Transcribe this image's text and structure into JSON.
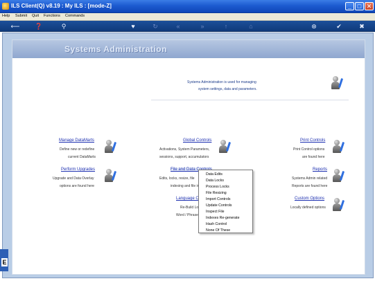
{
  "window": {
    "title": "ILS Client(Q) v8.19 : My ILS :          [mode-Z]",
    "min_glyph": "_",
    "max_glyph": "□",
    "close_glyph": "✕"
  },
  "menubar": {
    "items": [
      "Help",
      "Submit",
      "Quit",
      "Functions",
      "Commands"
    ]
  },
  "toolbar": {
    "icons": [
      "back-arrow-icon",
      "help-icon",
      "search-icon",
      "heart-icon",
      "refresh-icon",
      "rewind-icon",
      "fast-forward-icon",
      "up-icon",
      "lock-icon",
      "globe-icon",
      "check-icon",
      "close-icon"
    ]
  },
  "page": {
    "title": "Systems Administration",
    "intro_line1": "Systems Administration is used for managing",
    "intro_line2": "system settings, data and parameters."
  },
  "sections": {
    "manage_datamarts": {
      "title": "Manage DataMarts",
      "line1": "Define new or redefine",
      "line2": "current DataMarts"
    },
    "global_controls": {
      "title": "Global Controls",
      "line1": "Activations, System Parameters,",
      "line2": "sessions, support, accumulators"
    },
    "print_controls": {
      "title": "Print Controls",
      "line1": "Print Control options",
      "line2": "are found here"
    },
    "perform_upgrades": {
      "title": "Perform Upgrades",
      "line1": "Upgrade and Data Overlay",
      "line2": "options are found here"
    },
    "file_and_data_controls": {
      "title": "File and Data Controls",
      "line1": "Edits, locks, resize, file",
      "line2": "indexing and file in"
    },
    "reports": {
      "title": "Reports",
      "line1": "Systems Admin related",
      "line2": "Reports are found here"
    },
    "language_controls": {
      "title": "Language C",
      "line1": "Re-Build Lov",
      "line2": "Word / Phrase"
    },
    "custom_options": {
      "title": "Custom Options",
      "line1": "Locally defined options"
    }
  },
  "context_menu": {
    "items": [
      "Data Edits",
      "Data Locks",
      "Process Locks",
      "File Resizing",
      "Import Controls",
      "Update Controls",
      "Inspect File",
      "Indexes Re-generate",
      "Hash Control",
      "None Of These"
    ]
  },
  "side_stub": {
    "label": "E"
  }
}
